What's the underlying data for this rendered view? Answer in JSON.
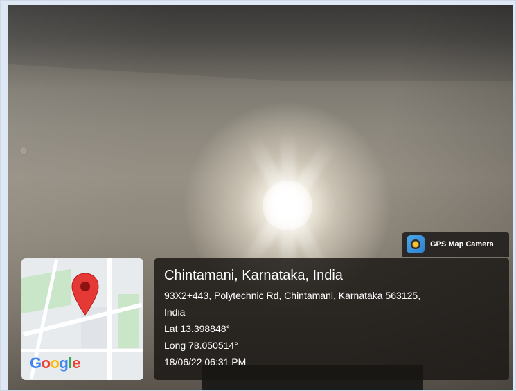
{
  "badge": {
    "label": "GPS Map Camera",
    "icon": "camera-app-icon"
  },
  "map": {
    "logo_text": "Google",
    "logo_colors": [
      "#4285F4",
      "#EA4335",
      "#FBBC05",
      "#4285F4",
      "#34A853",
      "#EA4335"
    ],
    "pin_color": "#E53935",
    "icon": "map-pin-icon"
  },
  "location": {
    "title": "Chintamani, Karnataka, India",
    "address_line1": "93X2+443, Polytechnic Rd, Chintamani, Karnataka 563125,",
    "address_line2": "India",
    "lat": "Lat 13.398848°",
    "long": "Long 78.050514°",
    "datetime": "18/06/22 06:31 PM"
  }
}
